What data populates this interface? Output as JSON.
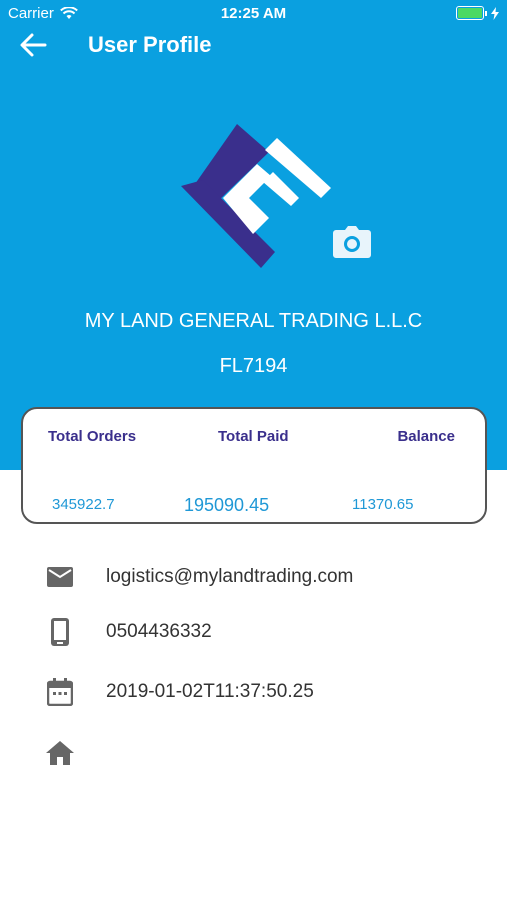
{
  "status_bar": {
    "carrier": "Carrier",
    "time": "12:25 AM"
  },
  "nav": {
    "title": "User Profile"
  },
  "profile": {
    "company_name": "MY LAND GENERAL TRADING L.L.C",
    "code": "FL7194"
  },
  "stats": {
    "total_orders": {
      "label": "Total Orders",
      "value": "345922.7"
    },
    "total_paid": {
      "label": "Total Paid",
      "value": "195090.45"
    },
    "balance": {
      "label": "Balance",
      "value": "11370.65"
    }
  },
  "contact": {
    "email": "logistics@mylandtrading.com",
    "phone": "0504436332",
    "date": "2019-01-02T11:37:50.25",
    "address": ""
  },
  "colors": {
    "header": "#0aa0e0",
    "accent_label": "#3a2f8c",
    "value": "#1f98d6",
    "logo_dark": "#3a2f8c"
  },
  "icons": [
    "wifi-icon",
    "battery-icon",
    "back-arrow-icon",
    "camera-icon",
    "email-icon",
    "phone-icon",
    "calendar-icon",
    "home-icon"
  ]
}
